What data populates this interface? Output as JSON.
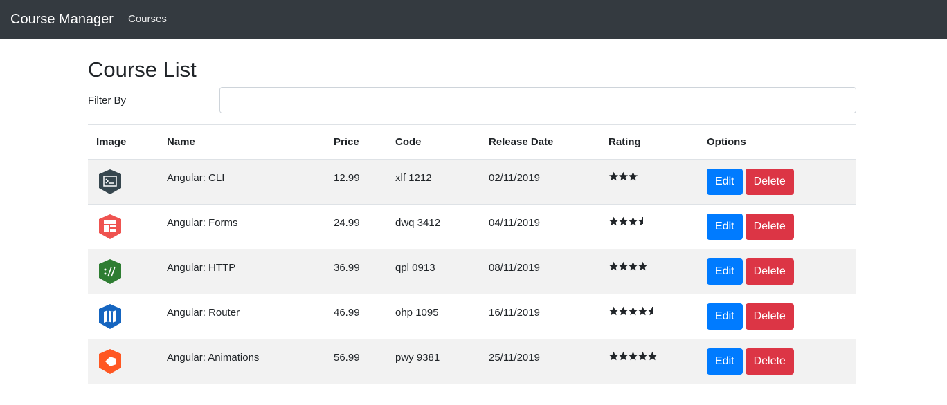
{
  "navbar": {
    "brand": "Course Manager",
    "links": [
      "Courses"
    ]
  },
  "page": {
    "title": "Course List",
    "filter_label": "Filter By",
    "filter_value": ""
  },
  "table": {
    "headers": [
      "Image",
      "Name",
      "Price",
      "Code",
      "Release Date",
      "Rating",
      "Options"
    ],
    "edit_label": "Edit",
    "delete_label": "Delete",
    "rows": [
      {
        "icon": "terminal-icon",
        "icon_color": "#37474f",
        "name": "Angular: CLI",
        "price": "12.99",
        "code": "xlf 1212",
        "release_date": "02/11/2019",
        "rating": 3
      },
      {
        "icon": "form-icon",
        "icon_color": "#ef5350",
        "name": "Angular: Forms",
        "price": "24.99",
        "code": "dwq 3412",
        "release_date": "04/11/2019",
        "rating": 3.5
      },
      {
        "icon": "http-icon",
        "icon_color": "#2e7d32",
        "name": "Angular: HTTP",
        "price": "36.99",
        "code": "qpl 0913",
        "release_date": "08/11/2019",
        "rating": 4
      },
      {
        "icon": "router-icon",
        "icon_color": "#1565c0",
        "name": "Angular: Router",
        "price": "46.99",
        "code": "ohp 1095",
        "release_date": "16/11/2019",
        "rating": 4.5
      },
      {
        "icon": "animations-icon",
        "icon_color": "#ff5722",
        "name": "Angular: Animations",
        "price": "56.99",
        "code": "pwy 9381",
        "release_date": "25/11/2019",
        "rating": 5
      }
    ]
  },
  "colors": {
    "navbar_bg": "#343a40",
    "primary": "#007bff",
    "danger": "#dc3545"
  }
}
